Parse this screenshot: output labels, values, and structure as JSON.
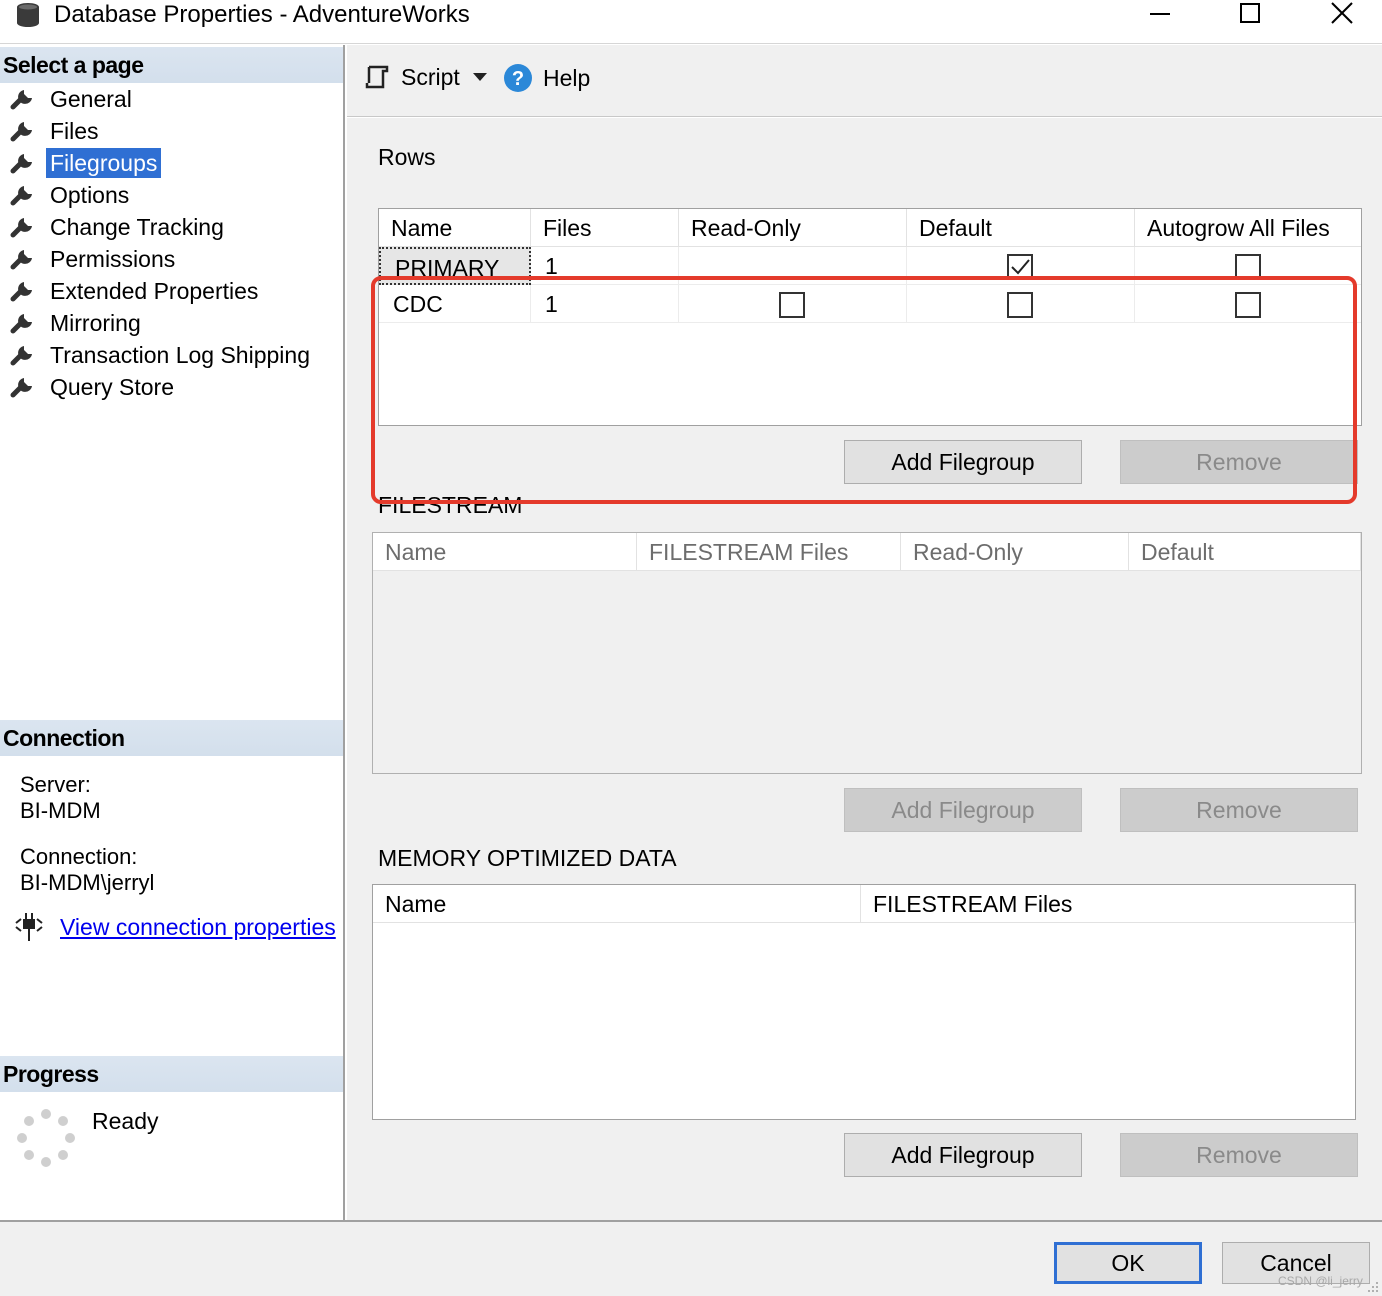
{
  "window": {
    "title": "Database Properties - AdventureWorks",
    "icon": "database-icon",
    "controls": [
      "minimize-icon",
      "maximize-icon",
      "close-icon"
    ]
  },
  "sidebar": {
    "select_page_heading": "Select a page",
    "pages": [
      {
        "label": "General",
        "icon": "wrench-icon",
        "selected": false
      },
      {
        "label": "Files",
        "icon": "wrench-icon",
        "selected": false
      },
      {
        "label": "Filegroups",
        "icon": "wrench-icon",
        "selected": true
      },
      {
        "label": "Options",
        "icon": "wrench-icon",
        "selected": false
      },
      {
        "label": "Change Tracking",
        "icon": "wrench-icon",
        "selected": false
      },
      {
        "label": "Permissions",
        "icon": "wrench-icon",
        "selected": false
      },
      {
        "label": "Extended Properties",
        "icon": "wrench-icon",
        "selected": false
      },
      {
        "label": "Mirroring",
        "icon": "wrench-icon",
        "selected": false
      },
      {
        "label": "Transaction Log Shipping",
        "icon": "wrench-icon",
        "selected": false
      },
      {
        "label": "Query Store",
        "icon": "wrench-icon",
        "selected": false
      }
    ],
    "connection_heading": "Connection",
    "server_label": "Server:",
    "server_value": "BI-MDM",
    "connection_label": "Connection:",
    "connection_value": "BI-MDM\\jerryl",
    "view_connection_link": "View connection properties",
    "progress_heading": "Progress",
    "progress_status": "Ready"
  },
  "toolbar": {
    "script_label": "Script",
    "help_label": "Help"
  },
  "rows_section": {
    "label": "Rows",
    "columns": [
      "Name",
      "Files",
      "Read-Only",
      "Default",
      "Autogrow All Files"
    ],
    "rows": [
      {
        "name": "PRIMARY",
        "files": "1",
        "read_only": null,
        "default": true,
        "autogrow": false
      },
      {
        "name": "CDC",
        "files": "1",
        "read_only": false,
        "default": false,
        "autogrow": false
      }
    ],
    "add_label": "Add Filegroup",
    "remove_label": "Remove"
  },
  "filestream_section": {
    "label": "FILESTREAM",
    "columns": [
      "Name",
      "FILESTREAM Files",
      "Read-Only",
      "Default"
    ],
    "add_label": "Add Filegroup",
    "remove_label": "Remove"
  },
  "memory_section": {
    "label": "MEMORY OPTIMIZED DATA",
    "columns": [
      "Name",
      "FILESTREAM Files"
    ],
    "add_label": "Add Filegroup",
    "remove_label": "Remove"
  },
  "footer": {
    "ok_label": "OK",
    "cancel_label": "Cancel",
    "watermark": "CSDN @li_jerry"
  },
  "colors": {
    "selection": "#2f6fd3",
    "highlight_box": "#e43a2b",
    "section_header": "#d3dfec",
    "dialog_background": "#f0f0f0"
  }
}
